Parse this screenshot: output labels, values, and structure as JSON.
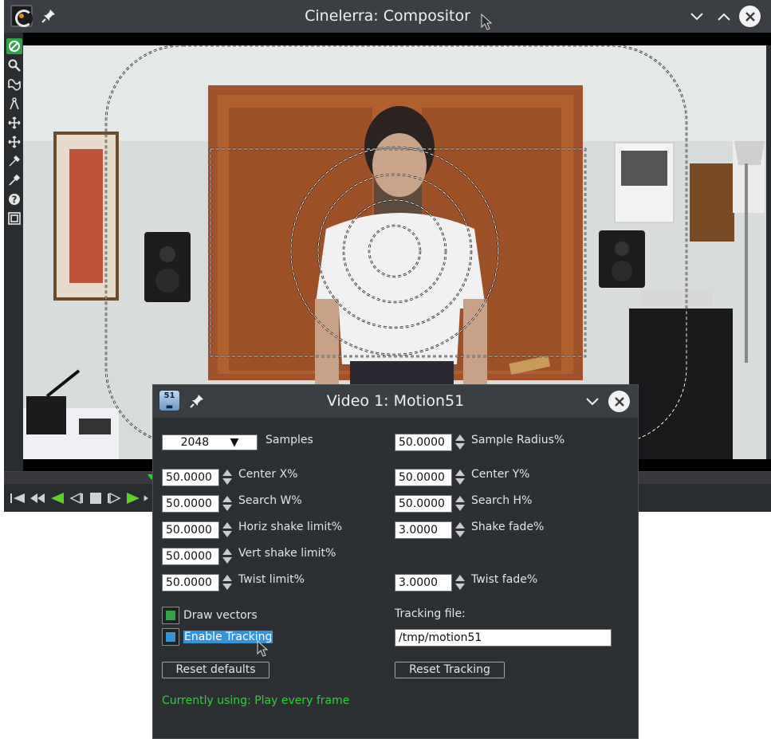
{
  "compositor": {
    "title": "Cinelerra: Compositor",
    "tools": [
      "protect-icon",
      "zoom-icon",
      "mask-icon",
      "ruler-icon",
      "camera-icon",
      "projector-icon",
      "crop-icon",
      "eyedropper-icon",
      "help-icon",
      "safe-regions-icon"
    ],
    "transport": [
      "rewind-icon",
      "fast-reverse-icon",
      "reverse-play-icon",
      "frame-reverse-icon",
      "stop-icon",
      "frame-forward-icon",
      "play-icon",
      "fast-forward-icon"
    ]
  },
  "dialog": {
    "title": "Video 1: Motion51",
    "samples": {
      "value": "2048",
      "label": "Samples"
    },
    "sample_radius": {
      "value": "50.0000",
      "label": "Sample Radius%"
    },
    "center_x": {
      "value": "50.0000",
      "label": "Center X%"
    },
    "center_y": {
      "value": "50.0000",
      "label": "Center Y%"
    },
    "search_w": {
      "value": "50.0000",
      "label": "Search W%"
    },
    "search_h": {
      "value": "50.0000",
      "label": "Search H%"
    },
    "horiz_shake": {
      "value": "50.0000",
      "label": "Horiz shake limit%"
    },
    "shake_fade": {
      "value": "3.0000",
      "label": "Shake fade%"
    },
    "vert_shake": {
      "value": "50.0000",
      "label": "Vert shake limit%"
    },
    "twist_limit": {
      "value": "50.0000",
      "label": "Twist limit%"
    },
    "twist_fade": {
      "value": "3.0000",
      "label": "Twist fade%"
    },
    "draw_vectors": {
      "label": "Draw vectors",
      "checked": true,
      "color": "#2ea443"
    },
    "enable_tracking": {
      "label": "Enable Tracking",
      "checked": true,
      "color": "#3593d8"
    },
    "tracking_file": {
      "label": "Tracking file:",
      "value": "/tmp/motion51"
    },
    "reset_defaults": "Reset defaults",
    "reset_tracking": "Reset Tracking",
    "status": "Currently using: Play every frame"
  }
}
